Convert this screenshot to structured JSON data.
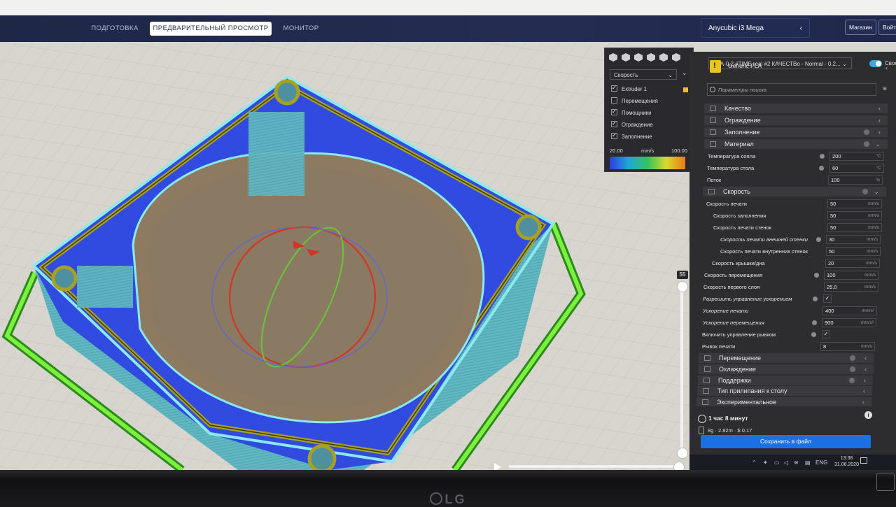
{
  "tabs": [
    "ПОДГОТОВКА",
    "ПРЕДВАРИТЕЛЬНЫЙ ПРОСМОТР",
    "МОНИТОР"
  ],
  "printer": "Anycubic i3 Mega",
  "top_buttons": {
    "store": "Магазин",
    "login": "Войти"
  },
  "profile": "PLA-0.2 #TIME real #2 КАЧЕСТВо - Normal - 0.2...",
  "toggle_label": "Свое",
  "material": "Generic PLA",
  "search_placeholder": "Параметры поиска",
  "legend": {
    "mode": "Скорость",
    "items": [
      {
        "label": "Extruder 1",
        "checked": true
      },
      {
        "label": "Перемещения",
        "checked": false
      },
      {
        "label": "Помощники",
        "checked": true
      },
      {
        "label": "Ограждение",
        "checked": true
      },
      {
        "label": "Заполнение",
        "checked": true
      }
    ],
    "min": "20.00",
    "unit": "mm/s",
    "max": "100.00"
  },
  "layer": "55",
  "categories_top": [
    "Качество",
    "Ограждение",
    "Заполнение",
    "Материал"
  ],
  "material_settings": [
    {
      "label": "Температура сопла",
      "value": "200",
      "unit": "°C"
    },
    {
      "label": "Температура стола",
      "value": "60",
      "unit": "°C"
    },
    {
      "label": "Поток",
      "value": "100",
      "unit": "%"
    }
  ],
  "speed_category": "Скорость",
  "speed_settings": [
    {
      "label": "Скорость печати",
      "value": "50",
      "unit": "mm/s"
    },
    {
      "label": "Скорость заполнения",
      "value": "50",
      "unit": "mm/s"
    },
    {
      "label": "Скорость печати стенок",
      "value": "50",
      "unit": "mm/s"
    },
    {
      "label": "Скорость печати внешней стенки",
      "value": "30",
      "unit": "mm/s"
    },
    {
      "label": "Скорость печати внутренних стенок",
      "value": "50",
      "unit": "mm/s"
    },
    {
      "label": "Скорость крышки/дна",
      "value": "20",
      "unit": "mm/s"
    },
    {
      "label": "Скорость перемещения",
      "value": "100",
      "unit": "mm/s"
    },
    {
      "label": "Скорость первого слоя",
      "value": "25.0",
      "unit": "mm/s"
    },
    {
      "label": "Разрешить управление ускорением",
      "value": "✓",
      "unit": ""
    },
    {
      "label": "Ускорение печати",
      "value": "400",
      "unit": "mm/s²"
    },
    {
      "label": "Ускорение перемещения",
      "value": "900",
      "unit": "mm/s²"
    },
    {
      "label": "Включить управление рывком",
      "value": "✓",
      "unit": ""
    },
    {
      "label": "Рывок печати",
      "value": "8",
      "unit": "mm/s"
    }
  ],
  "categories_bottom": [
    "Перемещение",
    "Охлаждение",
    "Поддержки",
    "Тип прилипания к столу",
    "Экспериментальное"
  ],
  "estimate": {
    "time": "1 час 8 минут",
    "material": "8g · 2.82m · $ 0.17"
  },
  "save_button": "Сохранить в файл",
  "taskbar": {
    "lang": "ENG",
    "time": "13:38",
    "date": "31.08.2020"
  },
  "monitor_brand": "LG"
}
